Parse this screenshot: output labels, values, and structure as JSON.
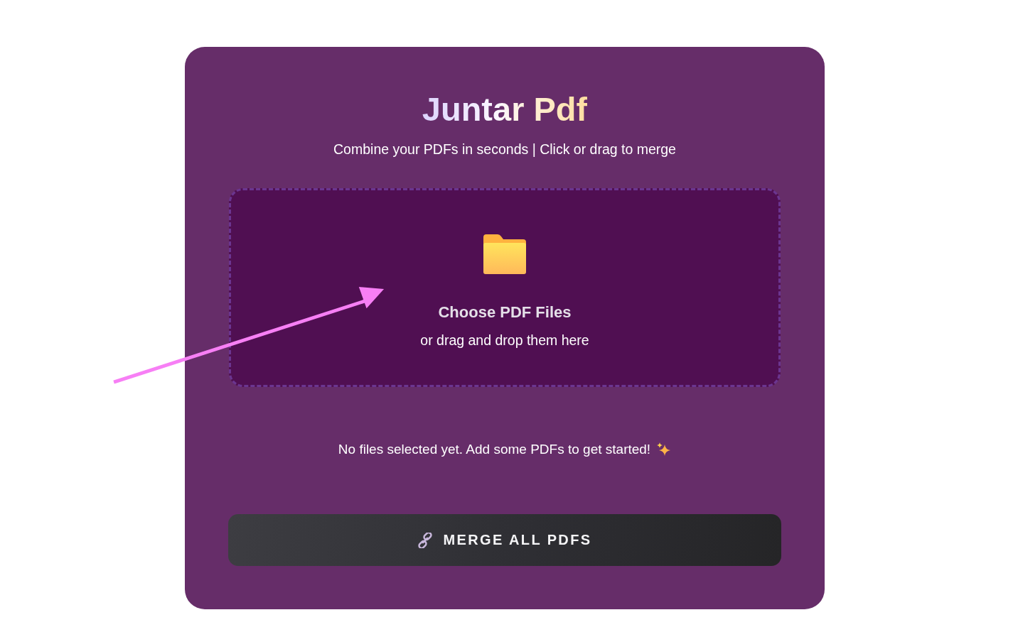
{
  "header": {
    "title": "Juntar Pdf",
    "subtitle": "Combine your PDFs in seconds | Click or drag to merge"
  },
  "upload_area": {
    "label": "Choose PDF Files",
    "hint": "or drag and drop them here"
  },
  "status_message": "No files selected yet. Add some PDFs to get started!",
  "merge_button": {
    "label": "MERGE ALL PDFS"
  }
}
